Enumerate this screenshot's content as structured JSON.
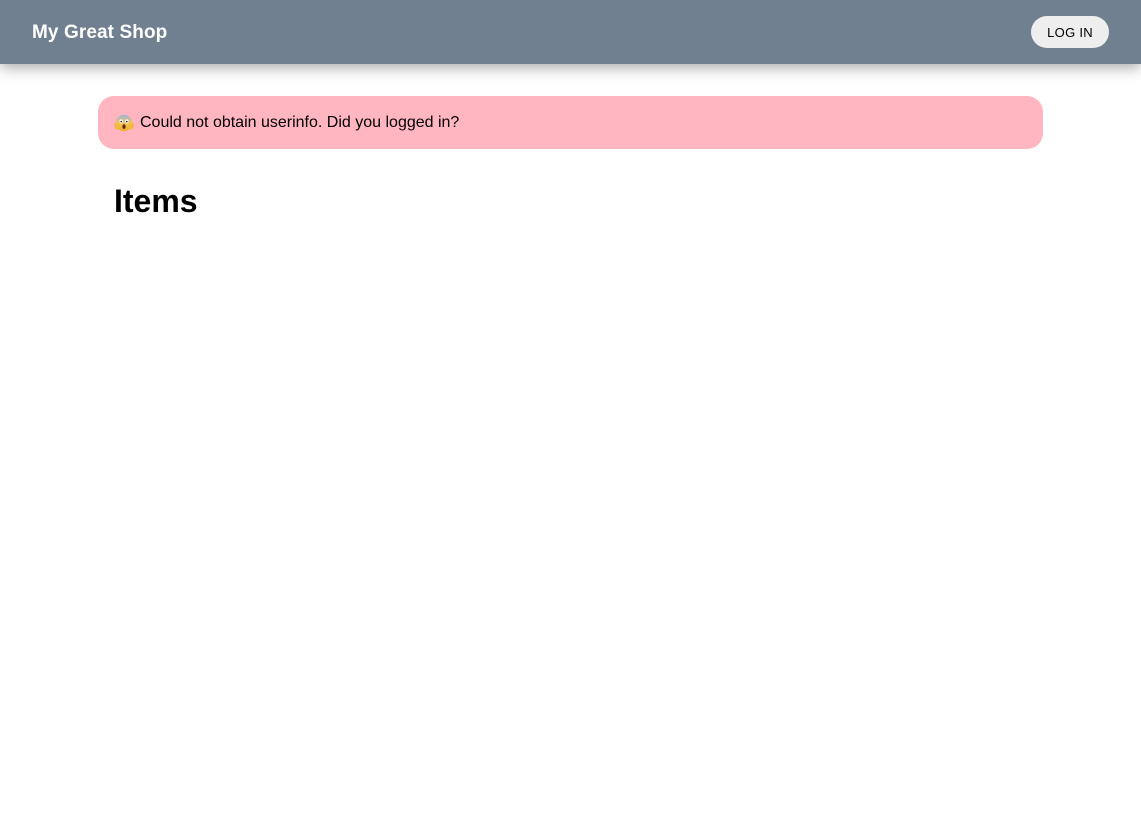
{
  "header": {
    "title": "My Great Shop",
    "login_label": "LOG IN",
    "background_color": "#708090"
  },
  "alert": {
    "icon": "scream-emoji-icon",
    "message": "Could not obtain userinfo. Did you logged in?",
    "background_color": "#ffb6c1"
  },
  "main": {
    "heading": "Items",
    "items": []
  }
}
